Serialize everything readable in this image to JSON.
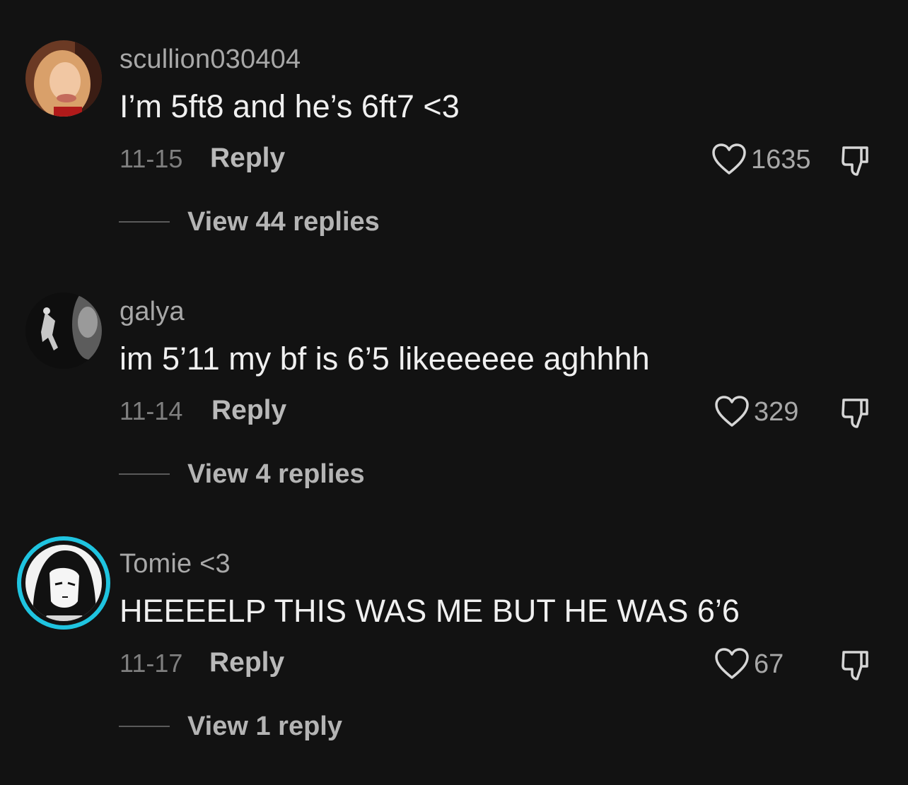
{
  "comments": [
    {
      "username": "scullion030404",
      "text": "I’m 5ft8 and he’s 6ft7 <3",
      "date": "11-15",
      "reply_label": "Reply",
      "likes": "1635",
      "view_replies": "View 44 replies",
      "avatar_icon": "avatar-photo-icon"
    },
    {
      "username": "galya",
      "text": "im 5’11 my bf is 6’5 likeeeeee aghhhh",
      "date": "11-14",
      "reply_label": "Reply",
      "likes": "329",
      "view_replies": "View 4 replies",
      "avatar_icon": "avatar-photo-icon"
    },
    {
      "username": "Tomie <3",
      "text": "HEEEELP THIS WAS ME BUT HE WAS 6’6",
      "date": "11-17",
      "reply_label": "Reply",
      "likes": "67",
      "view_replies": "View 1 reply",
      "avatar_icon": "avatar-photo-icon",
      "story_ring_color": "#1fc4e0"
    }
  ],
  "icons": {
    "like": "heart-icon",
    "dislike": "thumbs-down-icon"
  },
  "colors": {
    "background": "#121212",
    "story_ring": "#1fc4e0"
  }
}
